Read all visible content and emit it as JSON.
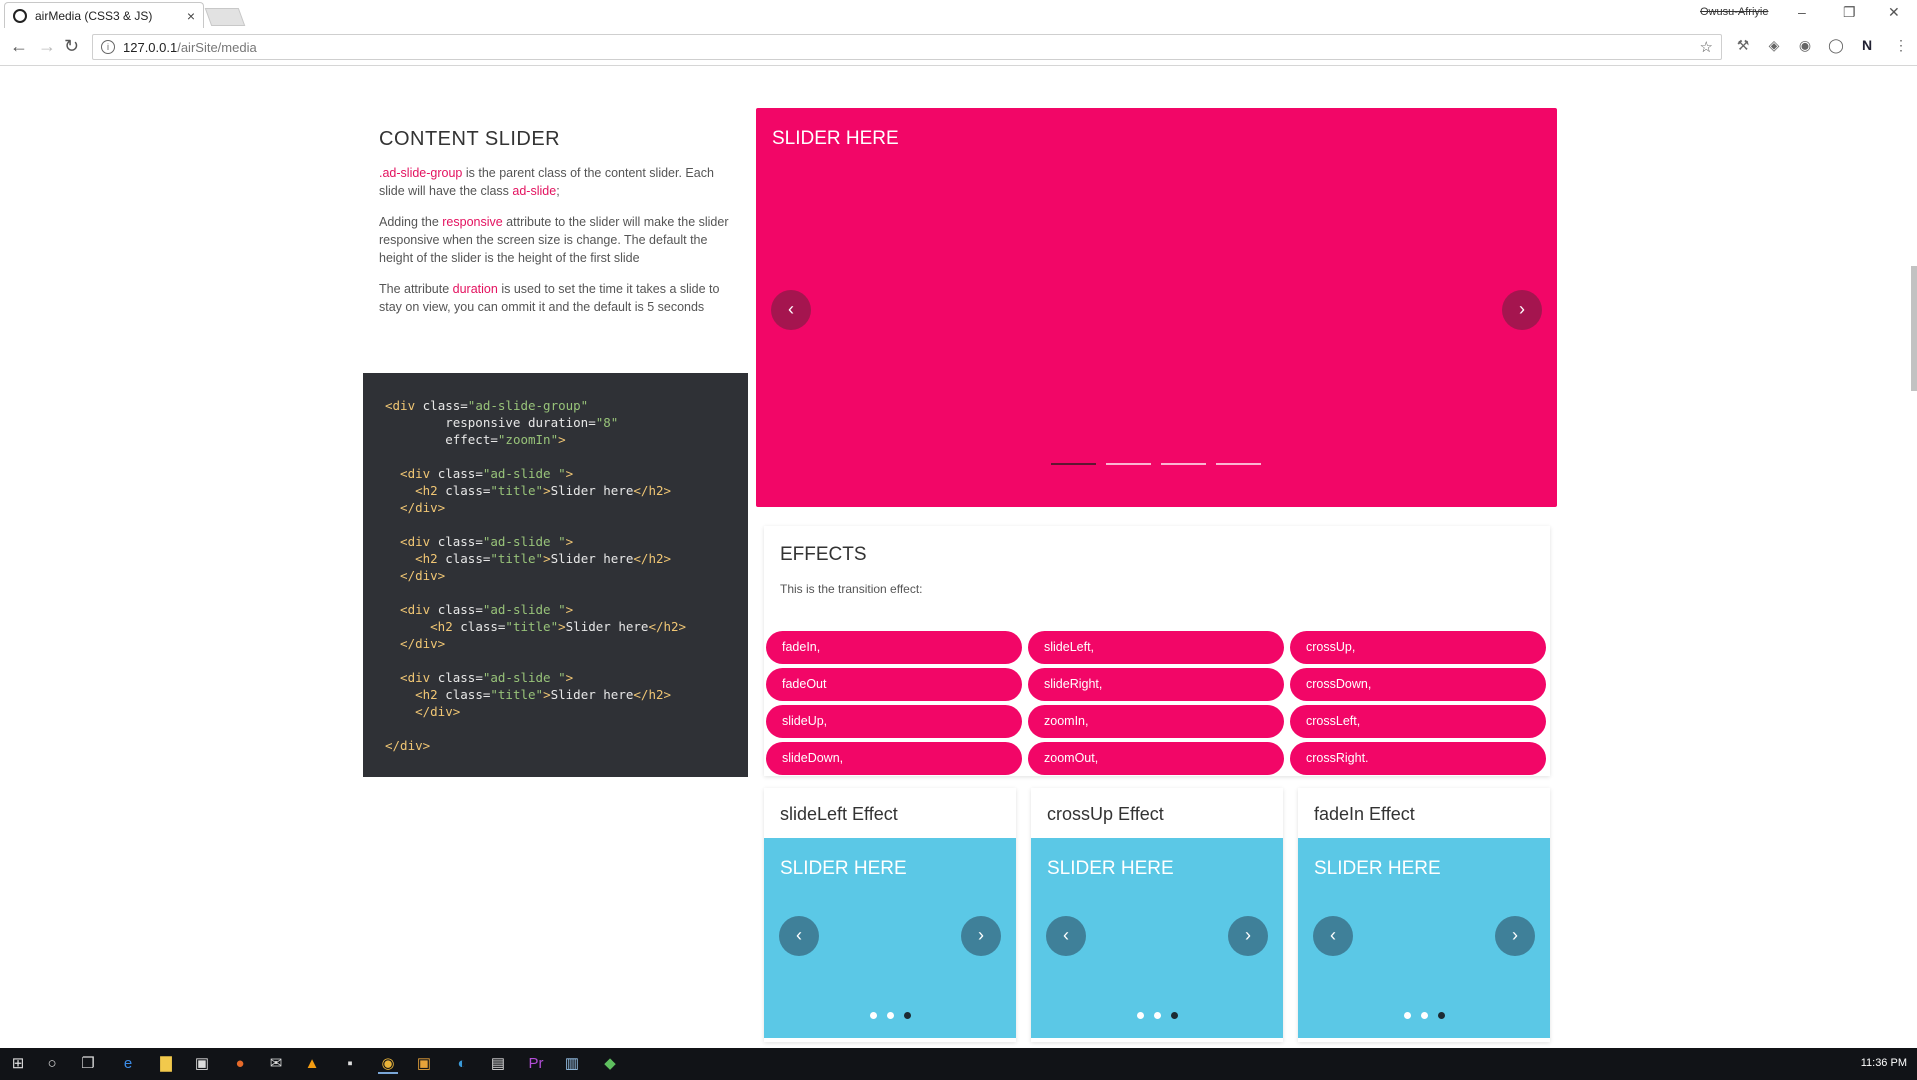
{
  "browser": {
    "tab_title": "airMedia (CSS3 & JS)",
    "tab_close": "×",
    "profile_name": "Owusu-Afriyie",
    "url_host": "127.0.0.1",
    "url_path": "/airSite/media"
  },
  "content_slider": {
    "heading": "CONTENT SLIDER",
    "p1": {
      "code1": ".ad-slide-group",
      "text1": " is the parent class of the content slider. Each slide will have the class ",
      "code2": "ad-slide",
      "text2": ";"
    },
    "p2": {
      "text1": "Adding the ",
      "code1": "responsive",
      "text2": " attribute to the slider will make the slider responsive when the screen size is change. The default the height of the slider is the height of the first slide"
    },
    "p3": {
      "text1": "The attribute ",
      "code1": "duration",
      "text2": " is used to set the time it takes a slide to stay on view, you can ommit it and the default is 5 seconds"
    }
  },
  "code_sample": {
    "lines": [
      {
        "parts": [
          [
            "t",
            "<div "
          ],
          [
            "a",
            "class="
          ],
          [
            "s",
            "\"ad-slide-group\""
          ]
        ]
      },
      {
        "parts": [
          [
            "a",
            "        responsive duration="
          ],
          [
            "s",
            "\"8\""
          ]
        ]
      },
      {
        "parts": [
          [
            "a",
            "        effect="
          ],
          [
            "s",
            "\"zoomIn\""
          ],
          [
            "t",
            ">"
          ]
        ]
      },
      {
        "parts": [
          [
            "a",
            ""
          ]
        ]
      },
      {
        "parts": [
          [
            "t",
            "  <div "
          ],
          [
            "a",
            "class="
          ],
          [
            "s",
            "\"ad-slide \""
          ],
          [
            "t",
            ">"
          ]
        ]
      },
      {
        "parts": [
          [
            "t",
            "    <h2 "
          ],
          [
            "a",
            "class="
          ],
          [
            "s",
            "\"title\""
          ],
          [
            "t",
            ">"
          ],
          [
            "a",
            "Slider here"
          ],
          [
            "t",
            "</h2>"
          ]
        ]
      },
      {
        "parts": [
          [
            "t",
            "  </div>"
          ]
        ]
      },
      {
        "parts": [
          [
            "a",
            ""
          ]
        ]
      },
      {
        "parts": [
          [
            "t",
            "  <div "
          ],
          [
            "a",
            "class="
          ],
          [
            "s",
            "\"ad-slide \""
          ],
          [
            "t",
            ">"
          ]
        ]
      },
      {
        "parts": [
          [
            "t",
            "    <h2 "
          ],
          [
            "a",
            "class="
          ],
          [
            "s",
            "\"title\""
          ],
          [
            "t",
            ">"
          ],
          [
            "a",
            "Slider here"
          ],
          [
            "t",
            "</h2>"
          ]
        ]
      },
      {
        "parts": [
          [
            "t",
            "  </div>"
          ]
        ]
      },
      {
        "parts": [
          [
            "a",
            ""
          ]
        ]
      },
      {
        "parts": [
          [
            "t",
            "  <div "
          ],
          [
            "a",
            "class="
          ],
          [
            "s",
            "\"ad-slide \""
          ],
          [
            "t",
            ">"
          ]
        ]
      },
      {
        "parts": [
          [
            "t",
            "      <h2 "
          ],
          [
            "a",
            "class="
          ],
          [
            "s",
            "\"title\""
          ],
          [
            "t",
            ">"
          ],
          [
            "a",
            "Slider here"
          ],
          [
            "t",
            "</h2>"
          ]
        ]
      },
      {
        "parts": [
          [
            "t",
            "  </div>"
          ]
        ]
      },
      {
        "parts": [
          [
            "a",
            ""
          ]
        ]
      },
      {
        "parts": [
          [
            "t",
            "  <div "
          ],
          [
            "a",
            "class="
          ],
          [
            "s",
            "\"ad-slide \""
          ],
          [
            "t",
            ">"
          ]
        ]
      },
      {
        "parts": [
          [
            "t",
            "    <h2 "
          ],
          [
            "a",
            "class="
          ],
          [
            "s",
            "\"title\""
          ],
          [
            "t",
            ">"
          ],
          [
            "a",
            "Slider here"
          ],
          [
            "t",
            "</h2>"
          ]
        ]
      },
      {
        "parts": [
          [
            "t",
            "    </div>"
          ]
        ]
      },
      {
        "parts": [
          [
            "a",
            ""
          ]
        ]
      },
      {
        "parts": [
          [
            "t",
            "</div>"
          ]
        ]
      }
    ]
  },
  "main_slider": {
    "title": "SLIDER HERE",
    "prev": "‹",
    "next": "›",
    "active_indicator": 0,
    "indicator_count": 4
  },
  "effects": {
    "heading": "EFFECTS",
    "description": "This is the transition effect:",
    "items": [
      "fadeIn,",
      "slideLeft,",
      "crossUp,",
      "fadeOut",
      "slideRight,",
      "crossDown,",
      "slideUp,",
      "zoomIn,",
      "crossLeft,",
      "slideDown,",
      "zoomOut,",
      "crossRight."
    ]
  },
  "demo_sliders": [
    {
      "heading": "slideLeft Effect",
      "title": "SLIDER HERE",
      "prev": "‹",
      "next": "›",
      "active_dot": 2
    },
    {
      "heading": "crossUp Effect",
      "title": "SLIDER HERE",
      "prev": "‹",
      "next": "›",
      "active_dot": 2
    },
    {
      "heading": "fadeIn Effect",
      "title": "SLIDER HERE",
      "prev": "‹",
      "next": "›",
      "active_dot": 2
    }
  ],
  "taskbar": {
    "time": "11:36 PM"
  },
  "colors": {
    "accent_pink": "#f20667",
    "demo_blue": "#5bc8e6",
    "code_bg": "#2f3136"
  }
}
